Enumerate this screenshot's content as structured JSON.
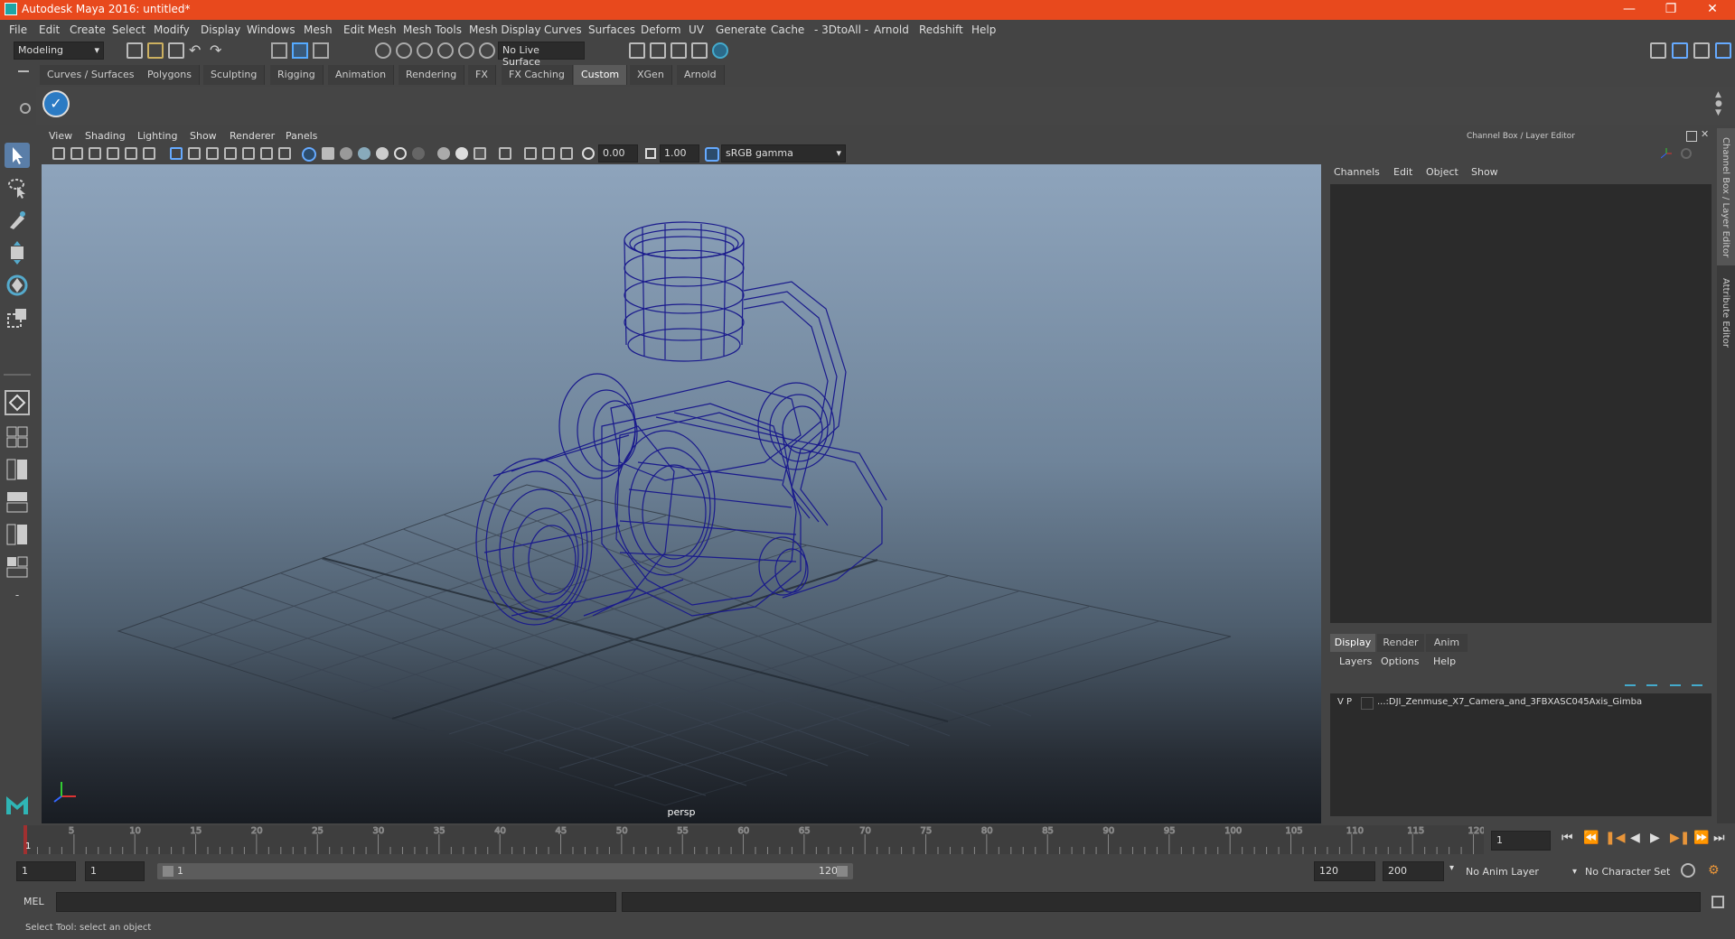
{
  "title_bar": {
    "title": "Autodesk Maya 2016: untitled*",
    "minimize": "—",
    "restore": "❐",
    "close": "✕"
  },
  "menu": [
    "File",
    "Edit",
    "Create",
    "Select",
    "Modify",
    "Display",
    "Windows",
    "Mesh",
    "Edit Mesh",
    "Mesh Tools",
    "Mesh Display",
    "Curves",
    "Surfaces",
    "Deform",
    "UV",
    "Generate",
    "Cache",
    "- 3DtoAll -",
    "Arnold",
    "Redshift",
    "Help"
  ],
  "status_line": {
    "mode_dropdown": "Modeling",
    "live_surface": "No Live Surface"
  },
  "shelf_tabs": [
    "Curves / Surfaces",
    "Polygons",
    "Sculpting",
    "Rigging",
    "Animation",
    "Rendering",
    "FX",
    "FX Caching",
    "Custom",
    "XGen",
    "Arnold"
  ],
  "shelf_active": "Custom",
  "viewport": {
    "menu": [
      "View",
      "Shading",
      "Lighting",
      "Show",
      "Renderer",
      "Panels"
    ],
    "exposure": "0.00",
    "gamma": "1.00",
    "color_space": "sRGB gamma",
    "camera_label": "persp"
  },
  "channel_box": {
    "title": "Channel Box / Layer Editor",
    "menu": [
      "Channels",
      "Edit",
      "Object",
      "Show"
    ]
  },
  "layer_editor": {
    "tabs": [
      "Display",
      "Render",
      "Anim"
    ],
    "menu": [
      "Layers",
      "Options",
      "Help"
    ],
    "layer": {
      "v": "V",
      "p": "P",
      "name": "...:DJI_Zenmuse_X7_Camera_and_3FBXASC045Axis_Gimba"
    }
  },
  "side_tabs": [
    "Channel Box / Layer Editor",
    "Attribute Editor"
  ],
  "time_slider": {
    "ticks": [
      "5",
      "10",
      "15",
      "20",
      "25",
      "30",
      "35",
      "40",
      "45",
      "50",
      "55",
      "60",
      "65",
      "70",
      "75",
      "80",
      "85",
      "90",
      "95",
      "100",
      "105",
      "110",
      "115",
      "120"
    ],
    "current_marker": "1",
    "current_frame": "1"
  },
  "range_slider": {
    "start": "1",
    "start_inner": "1",
    "bar_start": "1",
    "bar_end": "120",
    "end_inner": "120",
    "end": "200",
    "anim_layer": "No Anim Layer",
    "character_set": "No Character Set"
  },
  "command_line": {
    "label": "MEL"
  },
  "help_line": {
    "text": "Select Tool: select an object"
  },
  "colors": {
    "title_bar": "#e8491d",
    "wireframe": "#1a1a8c",
    "active_tab": "#5a5a5a"
  }
}
